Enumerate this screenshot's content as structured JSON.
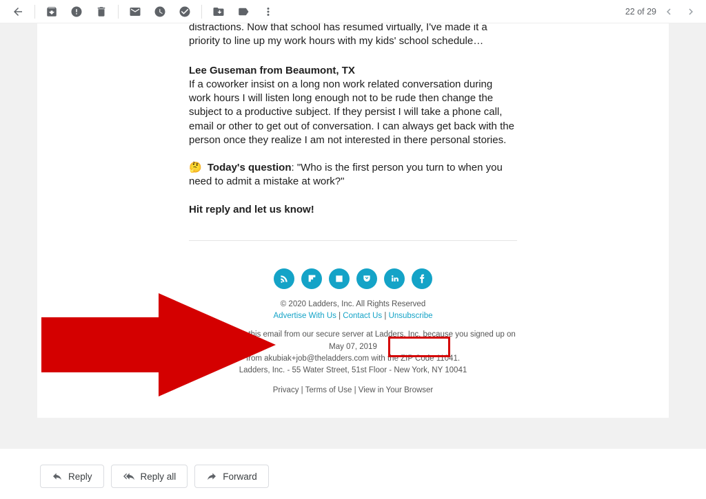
{
  "toolbar": {
    "counter": "22 of 29"
  },
  "body": {
    "cutoff_para": "distractions. Now that school has resumed virtually, I've made it a priority to line up my work hours with my kids' school schedule…",
    "author": "Lee Guseman from Beaumont, TX",
    "author_quote": "If a coworker insist on a long non work related conversation during work hours I will listen long enough not to be rude then change the subject to a productive subject. If they persist I will take a phone call, email or other to get out of conversation. I can always get back with the person once they realize I am not interested in there personal stories.",
    "question_emoji": "🤔",
    "question_label": "Today's question",
    "question_text": ": \"Who is the first person you turn to when you need to admit a mistake at work?\"",
    "cta": "Hit reply and let us know!"
  },
  "footer": {
    "copyright": "© 2020 Ladders, Inc. All Rights Reserved",
    "advertise": "Advertise With Us",
    "contact": "Contact Us",
    "unsubscribe": "Unsubscribe",
    "disclosure1": "You're receiving this email from our secure server at Ladders, Inc. because you signed up on May 07, 2019",
    "disclosure2": "from akubiak+job@theladders.com with the ZIP Code 11041.",
    "address": "Ladders, Inc. - 55 Water Street, 51st Floor - New York, NY 10041",
    "privacy": "Privacy",
    "terms": "Terms of Use",
    "browser": "View in Your Browser"
  },
  "actions": {
    "reply": "Reply",
    "reply_all": "Reply all",
    "forward": "Forward"
  },
  "social": {
    "rss": "rss-icon",
    "flipboard": "flipboard-icon",
    "news": "news-icon",
    "pocket": "pocket-icon",
    "linkedin": "linkedin-icon",
    "facebook": "facebook-icon"
  }
}
